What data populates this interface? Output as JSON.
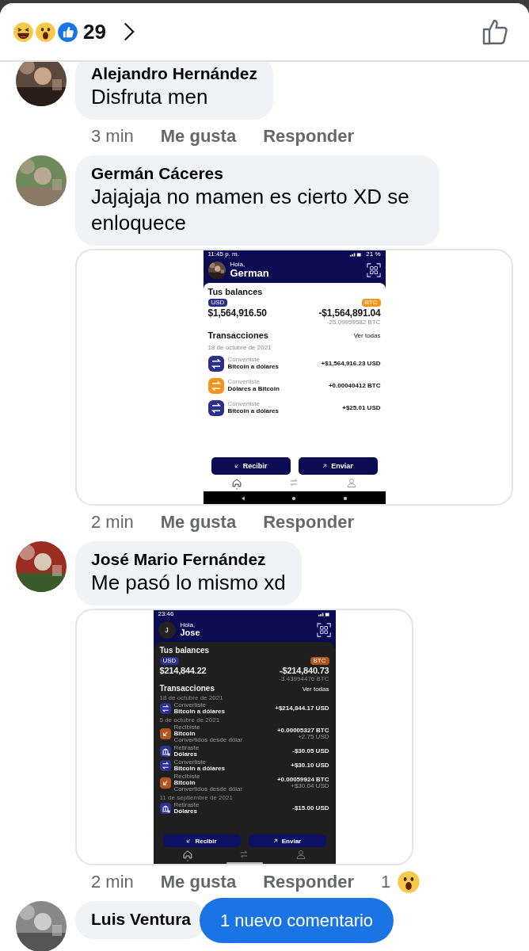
{
  "header": {
    "reactions": [
      {
        "kind": "haha"
      },
      {
        "kind": "wow"
      },
      {
        "kind": "like"
      }
    ],
    "reaction_count": "29"
  },
  "comments": [
    {
      "author": "Alejandro Hernández",
      "text": "Disfruta men",
      "meta": {
        "time": "3 min",
        "like": "Me gusta",
        "reply": "Responder"
      }
    },
    {
      "author": "Germán Cáceres",
      "text": "Jajajaja no mamen es cierto XD se enloquece",
      "attachment": {
        "kind": "light",
        "status": {
          "time": "11:45 p. m.",
          "battery": "21 %"
        },
        "greeting": "Hola,",
        "user": "German",
        "balances_title": "Tus balances",
        "usd": {
          "label": "USD",
          "amount": "$1,564,916.50"
        },
        "btc": {
          "label": "BTC",
          "amount": "-$1,564,891.04",
          "sub": "-25.09959582 BTC"
        },
        "transactions_title": "Transacciones",
        "see_all": "Ver todas",
        "groups": [
          {
            "date": "18 de octubre de 2021",
            "items": [
              {
                "kind": "convert",
                "color": "#2b2f8c",
                "label": "Convertiste",
                "title": "Bitcoin a dólares",
                "amount": "+$1,564,916.23 USD"
              },
              {
                "kind": "convert",
                "color": "#f7941d",
                "label": "Convertiste",
                "title": "Dólares a Bitcoin",
                "amount": "+0.00040412 BTC"
              },
              {
                "kind": "convert",
                "color": "#2b2f8c",
                "label": "Convertiste",
                "title": "Bitcoin a dólares",
                "amount": "+$25.01 USD"
              }
            ]
          }
        ],
        "actions": [
          {
            "kind": "receive",
            "label": "Recibir"
          },
          {
            "kind": "send",
            "label": "Enviar"
          }
        ],
        "nav": [
          {
            "kind": "home",
            "selected": true
          },
          {
            "kind": "transfers",
            "selected": false
          },
          {
            "kind": "profile",
            "selected": false
          }
        ],
        "system_nav": {
          "kind": "buttons"
        }
      },
      "meta": {
        "time": "2 min",
        "like": "Me gusta",
        "reply": "Responder"
      }
    },
    {
      "author": "José Mario Fernández",
      "text": "Me pasó lo mismo xd",
      "attachment": {
        "kind": "dark",
        "status": {
          "time": "23:46"
        },
        "greeting": "Hola,",
        "user": "Jose",
        "avatar": {
          "kind": "initial",
          "text": "J"
        },
        "balances_title": "Tus balances",
        "usd": {
          "label": "USD",
          "amount": "$214,844.22"
        },
        "btc": {
          "label": "BTC",
          "amount": "-$214,840.73",
          "sub": "-3.43994476 BTC"
        },
        "transactions_title": "Transacciones",
        "see_all": "Ver todas",
        "groups": [
          {
            "date": "18 de octubre de 2021",
            "items": [
              {
                "kind": "convert",
                "color": "#2c3192",
                "label": "Convertiste",
                "title": "Bitcoin a dólares",
                "amount": "+$214,844.17 USD"
              }
            ]
          },
          {
            "date": "5 de octubre de 2021",
            "items": [
              {
                "kind": "receive",
                "color": "#b4541c",
                "label": "Recibiste",
                "title": "Bitcoin",
                "note": "Convertidos desde dólar",
                "amount": "+0.00005327 BTC",
                "sub": "+2.75 USD"
              },
              {
                "kind": "withdraw",
                "color": "#2c3192",
                "label": "Retiraste",
                "title": "Dólares",
                "amount": "-$30.05 USD"
              },
              {
                "kind": "convert",
                "color": "#2c3192",
                "label": "Convertiste",
                "title": "Bitcoin a dólares",
                "amount": "+$30.10 USD"
              },
              {
                "kind": "receive",
                "color": "#b4541c",
                "label": "Recibiste",
                "title": "Bitcoin",
                "note": "Convertidos desde dólar",
                "amount": "+0.00059924 BTC",
                "sub": "+$30.04 USD"
              }
            ]
          },
          {
            "date": "11 de septiembre de 2021",
            "items": [
              {
                "kind": "withdraw",
                "color": "#2c3192",
                "label": "Retiraste",
                "title": "Dólares",
                "amount": "-$15.00 USD"
              }
            ]
          }
        ],
        "actions": [
          {
            "kind": "receive",
            "label": "Recibir"
          },
          {
            "kind": "send",
            "label": "Enviar"
          }
        ],
        "nav": [
          {
            "kind": "home",
            "selected": true
          },
          {
            "kind": "transfers",
            "selected": false
          },
          {
            "kind": "profile",
            "selected": false
          }
        ],
        "system_nav": {
          "kind": "gesture"
        }
      },
      "meta": {
        "time": "2 min",
        "like": "Me gusta",
        "reply": "Responder",
        "reaction": {
          "kind": "wow",
          "count": "1"
        }
      }
    },
    {
      "author": "Luis Ventura"
    }
  ],
  "new_comments_button": "1 nuevo comentario"
}
